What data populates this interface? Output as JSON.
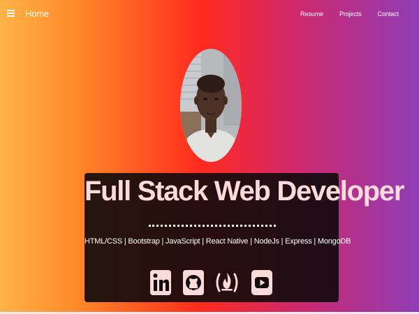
{
  "navbar": {
    "menu_icon": "hamburger-menu-icon",
    "brand": "Home",
    "links": [
      "Resume",
      "Projects",
      "Contact"
    ]
  },
  "hero": {
    "title": "Full Stack Web Developer",
    "skills": "HTML/CSS | Bootstrap | JavaScript | React Native | NodeJs | Express | MongoDB"
  },
  "social_icons": [
    "linkedin-icon",
    "github-icon",
    "freecodecamp-icon",
    "youtube-icon"
  ],
  "colors": {
    "gradient_start": "#ffb347",
    "gradient_mid": "#ff2a1e",
    "gradient_end": "#8f3cb6",
    "panel": "#0f0a0c",
    "title_text": "#fbdada",
    "icon": "#fbdada"
  }
}
